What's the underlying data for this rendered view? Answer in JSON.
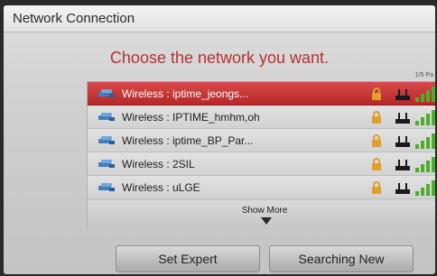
{
  "window": {
    "title": "Network Connection"
  },
  "main": {
    "heading": "Choose the network you want.",
    "page_indicator": "1/5 Pa"
  },
  "networks": [
    {
      "label": "Wireless : iptime_jeongs...",
      "selected": true,
      "locked": true,
      "signal_bars": 4
    },
    {
      "label": "Wireless : IPTIME_hmhm,oh",
      "selected": false,
      "locked": true,
      "signal_bars": 4
    },
    {
      "label": "Wireless : iptime_BP_Par...",
      "selected": false,
      "locked": true,
      "signal_bars": 4
    },
    {
      "label": "Wireless : 2SIL",
      "selected": false,
      "locked": true,
      "signal_bars": 4
    },
    {
      "label": "Wireless : uLGE",
      "selected": false,
      "locked": true,
      "signal_bars": 4
    }
  ],
  "show_more": {
    "label": "Show More"
  },
  "buttons": {
    "set_expert": "Set Expert",
    "searching_new": "Searching New"
  },
  "colors": {
    "accent": "#b8312f",
    "selected_row": "#c33535",
    "signal": "#4caf2a",
    "lock": "#e0a02a"
  },
  "icons": {
    "network": "wifi-network-icon",
    "lock": "lock-icon",
    "router": "router-icon",
    "signal": "signal-strength-icon",
    "more": "chevron-down-icon"
  }
}
